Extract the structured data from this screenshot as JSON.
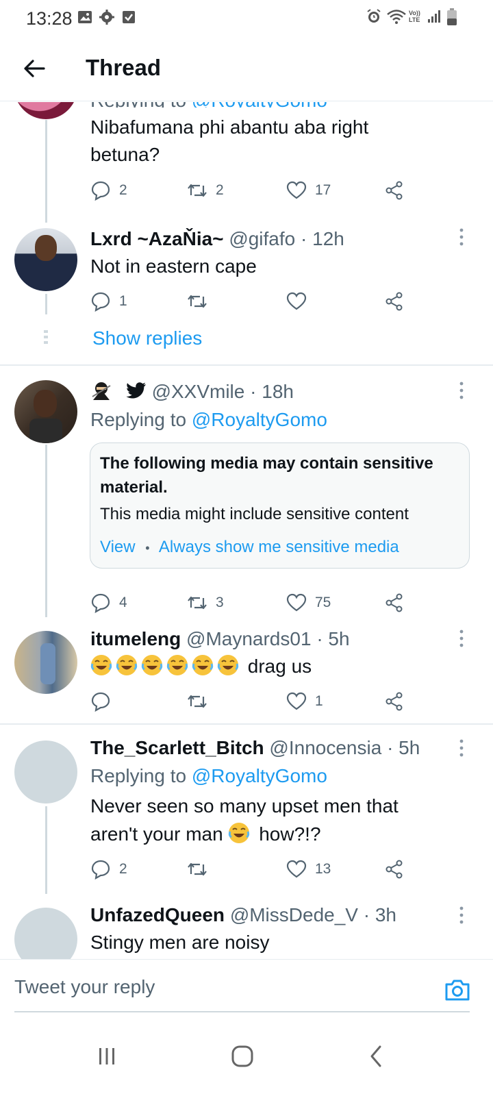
{
  "status_bar": {
    "time": "13:28",
    "icons_left": [
      "gallery-icon",
      "settings-icon",
      "checkbox-icon"
    ],
    "icons_right": [
      "alarm-icon",
      "wifi-icon",
      "volte-icon",
      "signal-icon",
      "battery-icon"
    ],
    "volte_label": "Vo)) LTE"
  },
  "header": {
    "title": "Thread"
  },
  "tweets": [
    {
      "id": "partial",
      "replying_to_prefix": "Replying to",
      "replying_to_handle": "@RoyaltyGomo",
      "text_lines": [
        "Nibafumana phi abantu aba right",
        "betuna?"
      ],
      "replies": "2",
      "retweets": "2",
      "likes": "17"
    },
    {
      "id": "lxrd",
      "name": "Lxrd ~AzaŇia~",
      "handle": "@gifafo",
      "time": "12h",
      "text": "Not in eastern cape",
      "replies": "1",
      "retweets": "",
      "likes": "",
      "show_replies": "Show replies"
    },
    {
      "id": "xxv",
      "name": "",
      "handle": "@XXVmile",
      "time": "18h",
      "replying_to_prefix": "Replying to",
      "replying_to_handle": "@RoyaltyGomo",
      "sensitive": {
        "title": "The following media may contain sensitive material.",
        "subtitle": "This media might include sensitive content",
        "view": "View",
        "separator": "•",
        "always": "Always show me sensitive media"
      },
      "replies": "4",
      "retweets": "3",
      "likes": "75"
    },
    {
      "id": "itumeleng",
      "name": "itumeleng",
      "handle": "@Maynards01",
      "time": "5h",
      "emoji_count": 6,
      "text": "drag us",
      "replies": "",
      "retweets": "",
      "likes": "1"
    },
    {
      "id": "scarlett",
      "name": "The_Scarlett_Bitch",
      "handle": "@Innocensia",
      "time": "5h",
      "replying_to_prefix": "Replying to",
      "replying_to_handle": "@RoyaltyGomo",
      "text_line1": "Never seen so many upset men that",
      "text_line2_a": "aren't your man",
      "text_line2_b": "how?!?",
      "replies": "2",
      "retweets": "",
      "likes": "13"
    },
    {
      "id": "unfazed",
      "name": "UnfazedQueen",
      "handle": "@MissDede_V",
      "time": "3h",
      "text": "Stingy men are noisy"
    }
  ],
  "meta_sep": "·",
  "reply_bar": {
    "placeholder": "Tweet your reply"
  },
  "colors": {
    "accent": "#1d9bf0",
    "muted": "#536471",
    "line": "#cfd9de"
  }
}
